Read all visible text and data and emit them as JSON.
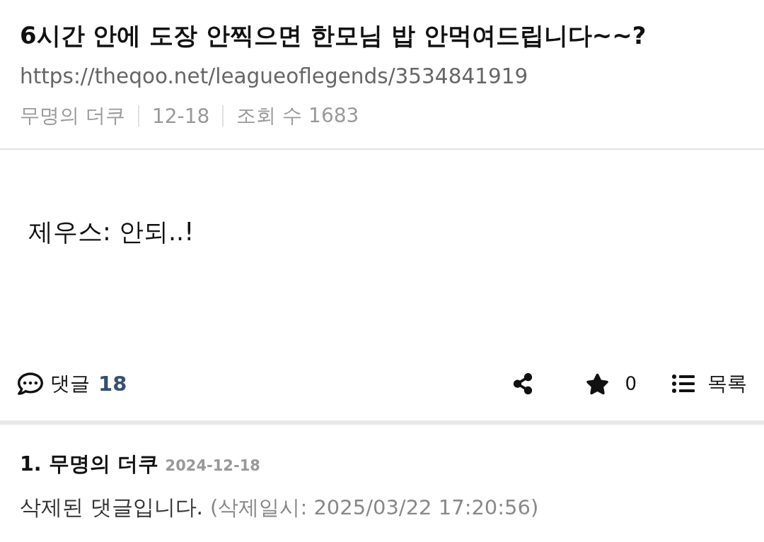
{
  "post": {
    "title": "6시간 안에 도장 안찍으면 한모님 밥 안먹여드립니다~~?",
    "url": "https://theqoo.net/leagueoflegends/3534841919",
    "meta": [
      "무명의 더쿠",
      "12-18",
      "조회 수 1683"
    ],
    "body": "제우스: 안되..!"
  },
  "actions": {
    "comments_label": "댓글",
    "comments_count": "18",
    "star_count": "0",
    "list_label": "목록"
  },
  "comments": [
    {
      "number": "1.",
      "author": "무명의 더쿠",
      "date": "2024-12-18",
      "text": "삭제된 댓글입니다.",
      "deleted_at": "(삭제일시: 2025/03/22 17:20:56)"
    }
  ]
}
